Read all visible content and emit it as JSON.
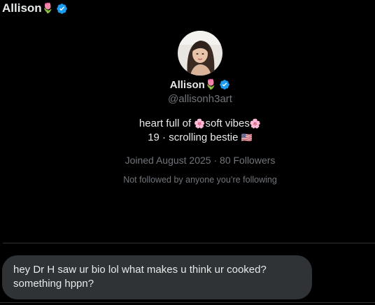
{
  "header": {
    "name": "Allison",
    "emoji": "🌷",
    "verified_icon": "verified-badge-icon"
  },
  "profile": {
    "avatar": "profile-avatar",
    "name": "Allison",
    "emoji": "🌷",
    "handle": "@allisonh3art",
    "bio_line1_a": "heart full of ",
    "bio_flower": "🌸",
    "bio_line1_b": "soft vibes",
    "bio_line2": "19 · scrolling bestie ",
    "bio_flag": "🇺🇸",
    "joined": "Joined August 2025",
    "separator": " · ",
    "followers": "80 Followers",
    "followed_note": "Not followed by anyone you’re following"
  },
  "message": {
    "text": "hey Dr H saw ur bio lol what makes u think ur cooked? something hppn?"
  },
  "colors": {
    "background": "#000000",
    "text": "#e7e9ea",
    "muted": "#71767b",
    "verified": "#1d9bf0",
    "bubble": "#2f3336"
  }
}
